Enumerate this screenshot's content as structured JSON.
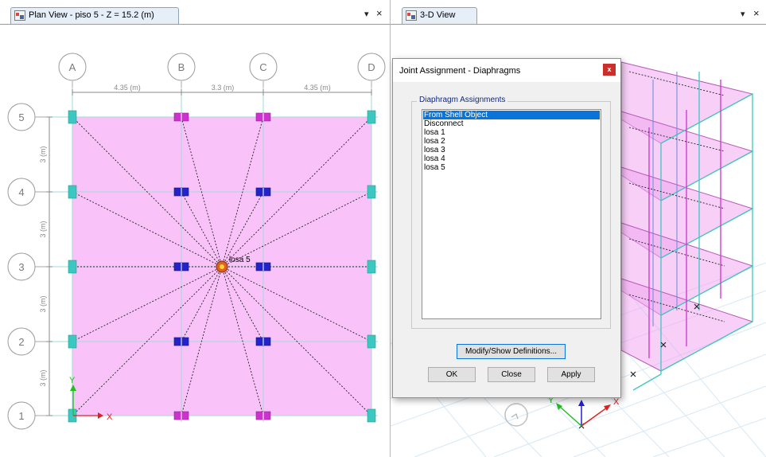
{
  "plan_view": {
    "tab_title": "Plan View - piso 5 - Z = 15.2 (m)",
    "menu_glyph": "▾",
    "close_glyph": "×",
    "grid_columns": [
      "A",
      "B",
      "C",
      "D"
    ],
    "grid_rows": [
      "5",
      "4",
      "3",
      "2",
      "1"
    ],
    "column_spacings": [
      "4.35 (m)",
      "3.3 (m)",
      "4.35 (m)"
    ],
    "row_spacings": [
      "3 (m)",
      "3 (m)",
      "3 (m)",
      "3 (m)"
    ],
    "diaphragm_label": "losa 5",
    "axis_x": "X",
    "axis_y": "Y",
    "colors": {
      "slab": "#f9c3f9",
      "column": "#3cc8c0",
      "beam": "#cc33cc",
      "central_joint": "#2323c8"
    }
  },
  "view_3d": {
    "tab_title": "3-D View",
    "menu_glyph": "▾",
    "close_glyph": "×",
    "axis_x": "X",
    "axis_y": "Y",
    "axis_z": "Z"
  },
  "dialog": {
    "title": "Joint Assignment - Diaphragms",
    "close_glyph": "x",
    "group_label": "Diaphragm Assignments",
    "items": [
      "From Shell Object",
      "Disconnect",
      "losa 1",
      "losa 2",
      "losa 3",
      "losa 4",
      "losa 5"
    ],
    "selected_index": 0,
    "modify_button": "Modify/Show Definitions...",
    "ok_button": "OK",
    "close_button": "Close",
    "apply_button": "Apply"
  }
}
